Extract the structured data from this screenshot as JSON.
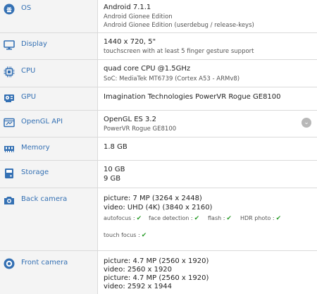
{
  "colors": {
    "label": "#3470b3",
    "icon": "#3470b3",
    "check": "#2e9e2e",
    "row_border": "#dadada",
    "label_bg": "#f4f4f4"
  },
  "specs": {
    "os": {
      "label": "OS",
      "icon": "android-os-icon",
      "lines": [
        "Android 7.1.1",
        "Android Gionee Edition",
        "Android Gionee Edition (userdebug / release-keys)"
      ]
    },
    "display": {
      "label": "Display",
      "icon": "monitor-icon",
      "lines": [
        "1440 x 720, 5\"",
        "touchscreen with at least 5 finger gesture support"
      ]
    },
    "cpu": {
      "label": "CPU",
      "icon": "cpu-chip-icon",
      "lines": [
        "quad core CPU @1.5GHz",
        "SoC: MediaTek MT6739 (Cortex A53 - ARMv8)"
      ]
    },
    "gpu": {
      "label": "GPU",
      "icon": "gpu-card-icon",
      "lines": [
        "Imagination Technologies PowerVR Rogue GE8100"
      ]
    },
    "opengl": {
      "label": "OpenGL API",
      "icon": "opengl-icon",
      "lines": [
        "OpenGL ES 3.2",
        "PowerVR Rogue GE8100"
      ]
    },
    "memory": {
      "label": "Memory",
      "icon": "memory-icon",
      "lines": [
        "1.8 GB"
      ]
    },
    "storage": {
      "label": "Storage",
      "icon": "storage-icon",
      "lines": [
        "10 GB",
        "9 GB"
      ]
    },
    "back_camera": {
      "label": "Back camera",
      "icon": "camera-icon",
      "lines": [
        "picture: 7 MP (3264 x 2448)",
        "video: UHD (4K) (3840 x 2160)"
      ],
      "features": [
        "autofocus :",
        "face detection :",
        "flash :",
        "HDR photo :",
        "touch focus :"
      ]
    },
    "front_camera": {
      "label": "Front camera",
      "icon": "front-camera-icon",
      "lines": [
        "picture: 4.7 MP (2560 x 1920)",
        "video: 2560 x 1920",
        "picture: 4.7 MP (2560 x 1920)",
        "video: 2592 x 1944"
      ]
    }
  },
  "check_glyph": "✔",
  "expand_glyph": "⌄"
}
